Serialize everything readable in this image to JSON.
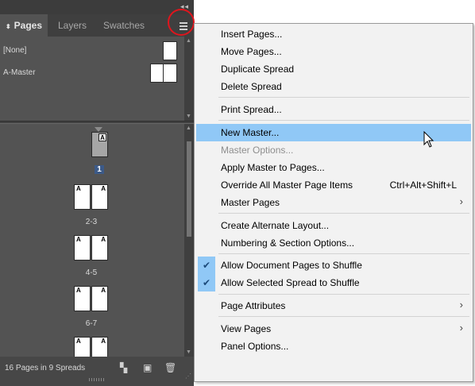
{
  "panel": {
    "collapse_glyph": "◂◂",
    "close_glyph": "✕",
    "tabs": [
      {
        "label": "Pages",
        "active": true
      },
      {
        "label": "Layers",
        "active": false
      },
      {
        "label": "Swatches",
        "active": false
      }
    ],
    "tab_chevron": "⬍",
    "masters": [
      {
        "label": "[None]"
      },
      {
        "label": "A-Master"
      }
    ],
    "spreads": [
      {
        "label": "1",
        "left_prefix": "",
        "right_prefix": "A"
      },
      {
        "label": "2-3",
        "left_prefix": "A",
        "right_prefix": "A"
      },
      {
        "label": "4-5",
        "left_prefix": "A",
        "right_prefix": "A"
      },
      {
        "label": "6-7",
        "left_prefix": "A",
        "right_prefix": "A"
      },
      {
        "label": "",
        "left_prefix": "A",
        "right_prefix": "A"
      }
    ],
    "footer": {
      "status": "16 Pages in 9 Spreads",
      "icons": [
        "edit-page-size-icon",
        "new-page-icon",
        "delete-page-icon"
      ]
    }
  },
  "menu": {
    "items": [
      {
        "label": "Insert Pages..."
      },
      {
        "label": "Move Pages..."
      },
      {
        "label": "Duplicate Spread"
      },
      {
        "label": "Delete Spread"
      },
      {
        "label": "Print Spread..."
      },
      {
        "label": "New Master...",
        "highlighted": true
      },
      {
        "label": "Master Options...",
        "disabled": true
      },
      {
        "label": "Apply Master to Pages..."
      },
      {
        "label": "Override All Master Page Items",
        "shortcut": "Ctrl+Alt+Shift+L"
      },
      {
        "label": "Master Pages",
        "submenu": true
      },
      {
        "label": "Create Alternate Layout..."
      },
      {
        "label": "Numbering & Section Options..."
      },
      {
        "label": "Allow Document Pages to Shuffle",
        "checked": true
      },
      {
        "label": "Allow Selected Spread to Shuffle",
        "checked": true
      },
      {
        "label": "Page Attributes",
        "submenu": true
      },
      {
        "label": "View Pages",
        "submenu": true
      },
      {
        "label": "Panel Options..."
      }
    ],
    "check_glyph": "✔",
    "submenu_glyph": "›"
  },
  "colors": {
    "panel_bg": "#535353",
    "menu_highlight": "#90c8f6",
    "callout_ring": "#e0151d"
  }
}
